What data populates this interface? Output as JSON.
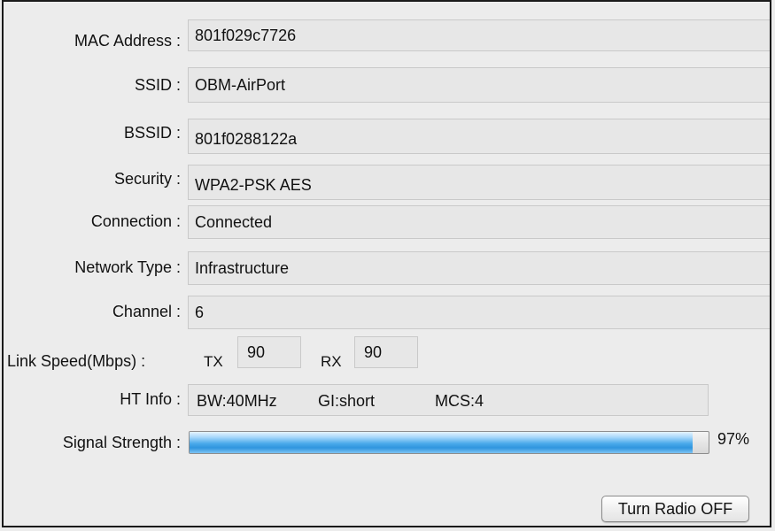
{
  "fields": {
    "mac": {
      "label": "MAC Address :",
      "value": "801f029c7726"
    },
    "ssid": {
      "label": "SSID :",
      "value": "OBM-AirPort"
    },
    "bssid": {
      "label": "BSSID :",
      "value": "801f0288122a"
    },
    "security": {
      "label": "Security :",
      "value": "WPA2-PSK AES"
    },
    "connection": {
      "label": "Connection :",
      "value": "Connected"
    },
    "network_type": {
      "label": "Network Type :",
      "value": "Infrastructure"
    },
    "channel": {
      "label": "Channel :",
      "value": "6"
    }
  },
  "link_speed": {
    "label": "Link Speed(Mbps) :",
    "tx_label": "TX",
    "tx_value": "90",
    "rx_label": "RX",
    "rx_value": "90"
  },
  "ht_info": {
    "label": "HT Info :",
    "bw": "BW:40MHz",
    "gi": "GI:short",
    "mcs": "MCS:4"
  },
  "signal": {
    "label": "Signal Strength :",
    "percent": 97,
    "percent_text": "97%",
    "fill_color": "#3d9fe6"
  },
  "button": {
    "label": "Turn Radio OFF"
  }
}
